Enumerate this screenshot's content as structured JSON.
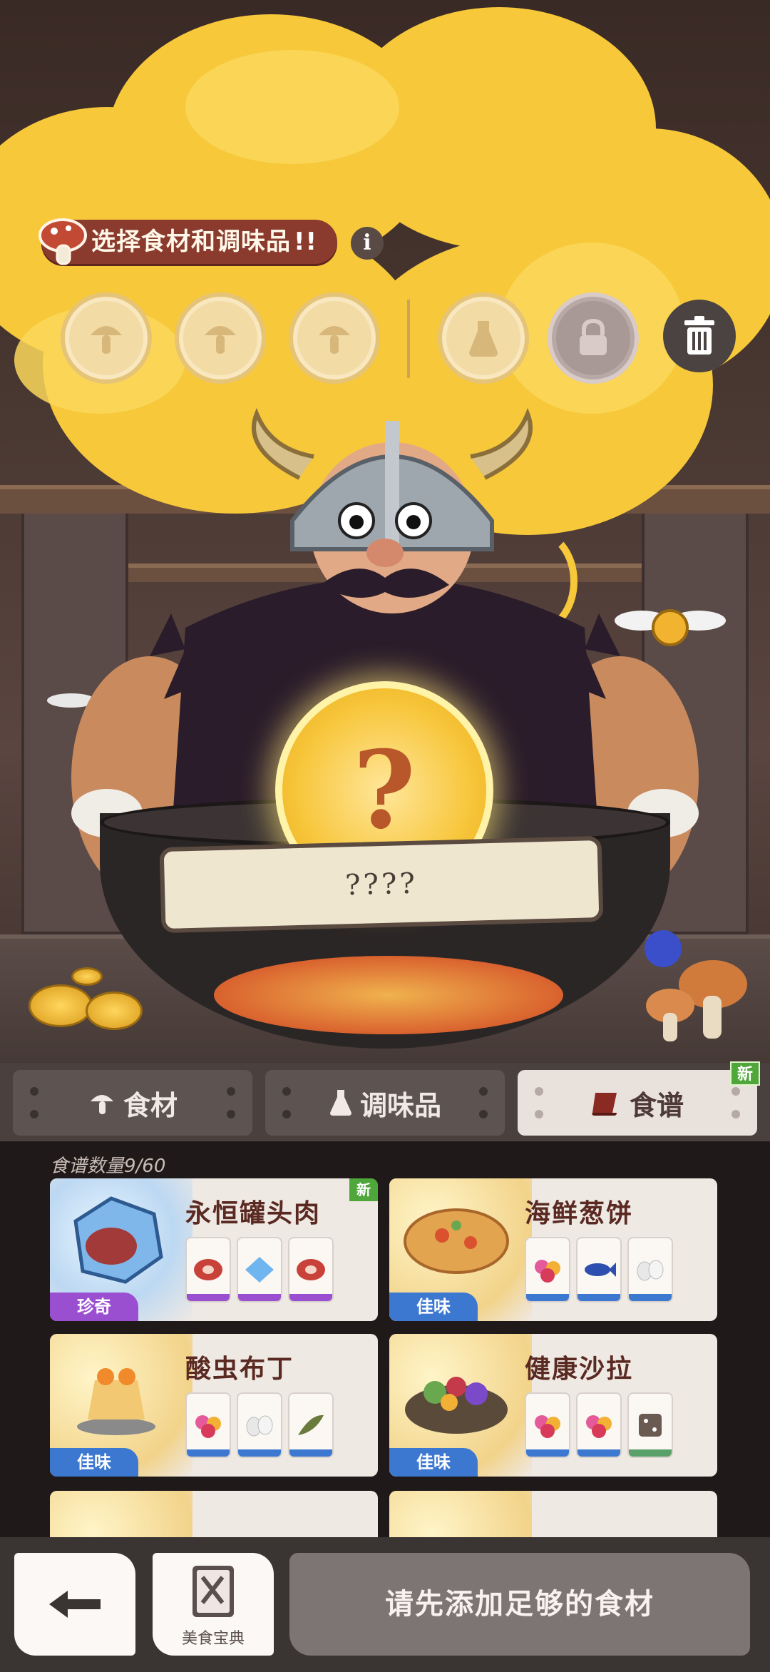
{
  "header": {
    "title": "选择食材和调味品",
    "exclaim": "!!",
    "info_icon": "info-icon",
    "trash_icon": "trash-icon",
    "slots": [
      {
        "type": "ingredient",
        "icon": "mushroom-icon"
      },
      {
        "type": "ingredient",
        "icon": "mushroom-icon"
      },
      {
        "type": "ingredient",
        "icon": "mushroom-icon"
      },
      {
        "type": "seasoning",
        "icon": "flask-icon"
      },
      {
        "type": "locked",
        "icon": "lock-icon"
      }
    ]
  },
  "cooking": {
    "result_symbol": "?",
    "result_name": "????"
  },
  "tabs": [
    {
      "label": "食材",
      "icon": "mushroom-icon"
    },
    {
      "label": "调味品",
      "icon": "flask-icon"
    },
    {
      "label": "食谱",
      "icon": "recipe-scroll-icon",
      "active": true,
      "badge": "新"
    }
  ],
  "recipes": {
    "count_label": "食谱数量9/60",
    "items": [
      {
        "name": "永恒罐头肉",
        "rarity": "珍奇",
        "rarity_class": "rare",
        "badge": "新",
        "ingredients": [
          "meat-icon",
          "ice-crystal-icon",
          "meat-icon"
        ]
      },
      {
        "name": "海鲜葱饼",
        "rarity": "佳味",
        "rarity_class": "good",
        "badge": "",
        "ingredients": [
          "berries-icon",
          "fish-icon",
          "eggs-icon"
        ]
      },
      {
        "name": "酸虫布丁",
        "rarity": "佳味",
        "rarity_class": "good",
        "badge": "",
        "ingredients": [
          "berries-icon",
          "eggs-icon",
          "herb-icon"
        ]
      },
      {
        "name": "健康沙拉",
        "rarity": "佳味",
        "rarity_class": "good",
        "badge": "",
        "ingredients": [
          "berries-icon",
          "berries-icon",
          "mystery-dice-icon"
        ]
      }
    ]
  },
  "bottom": {
    "back_icon": "back-arrow-icon",
    "codex_label": "美食宝典",
    "codex_icon": "cookbook-icon",
    "cook_label": "请先添加足够的食材"
  },
  "colors": {
    "cloud": "#f6c83a",
    "title_pill": "#8a3b2e",
    "rare": "#9a4fd1",
    "good": "#3d78d0",
    "new_badge": "#4fa63b"
  }
}
